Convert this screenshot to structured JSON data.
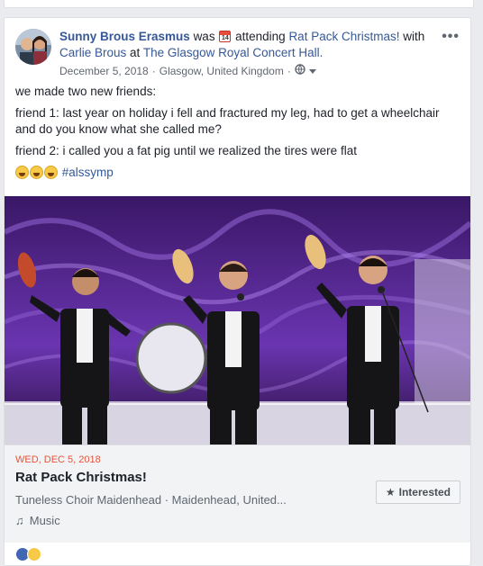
{
  "post": {
    "author": "Sunny Brous Erasmus",
    "was_text": "was",
    "activity_text": "attending",
    "event_link": "Rat Pack Christmas!",
    "with_text": "with",
    "tagged_person": "Carlie Brous",
    "at_text": "at",
    "location_link": "The Glasgow Royal Concert Hall.",
    "date": "December 5, 2018",
    "place": "Glasgow, United Kingdom",
    "separator": "·",
    "more_icon": "more-dots-icon",
    "calendar_icon_text": "14",
    "lines": [
      "we made two new friends:",
      "friend 1: last year on holiday i fell and fractured my leg, had to get a wheelchair and do you know what she called me?",
      "friend 2: i called you a fat pig until we realized the tires were flat"
    ],
    "hashtag": "#alssymp"
  },
  "event": {
    "date": "WED, DEC 5, 2018",
    "title": "Rat Pack Christmas!",
    "location": "Tuneless Choir Maidenhead · Maidenhead, United...",
    "category": "Music",
    "interested_label": "Interested",
    "star_glyph": "★",
    "music_glyph": "♫"
  },
  "colors": {
    "link": "#365899",
    "event_date": "#e4553c",
    "stage_purple": "#5a2a9c"
  }
}
